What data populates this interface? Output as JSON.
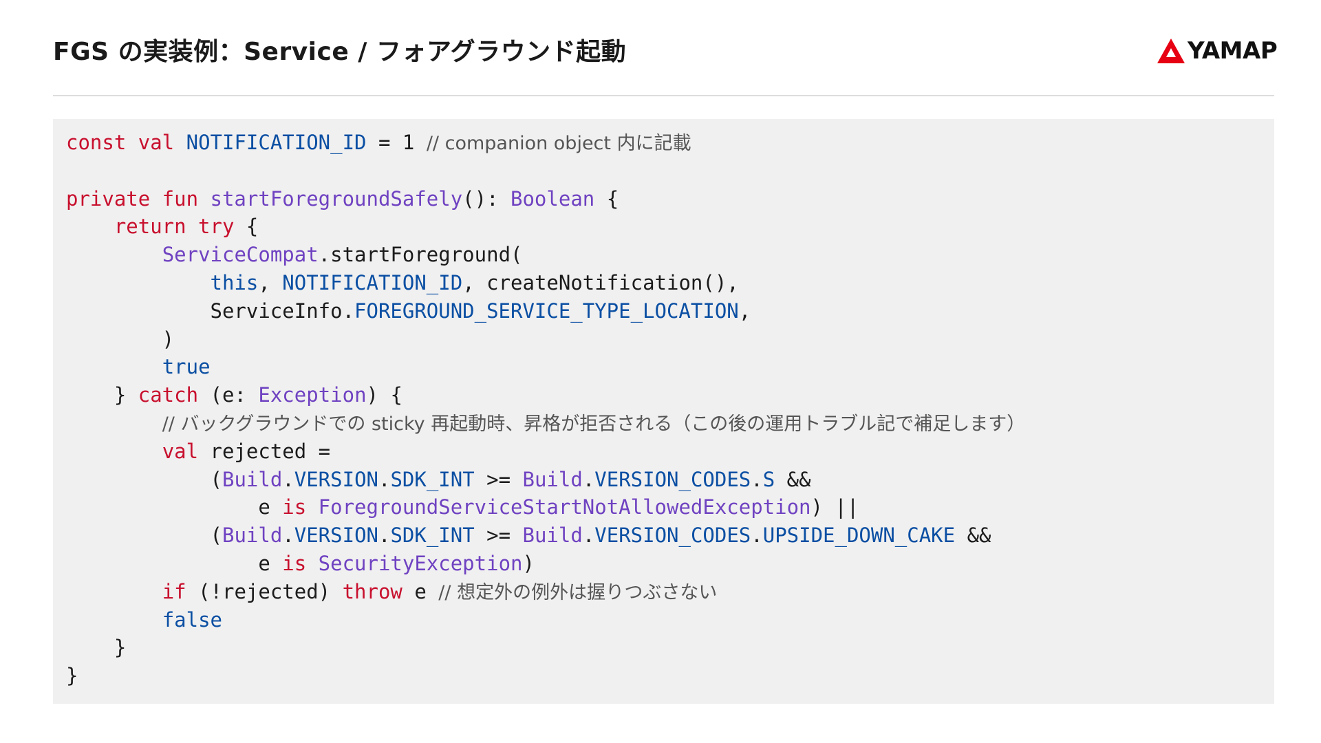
{
  "header": {
    "title": "FGS の実装例：Service / フォアグラウンド起動",
    "logo_text": "YAMAP"
  },
  "colors": {
    "keyword": "#c8102e",
    "type": "#6f42c1",
    "constant": "#0b4fa3",
    "comment": "#555555",
    "code_background": "#f0f0f0",
    "logo_red": "#e60012"
  },
  "code": {
    "lines": [
      [
        {
          "t": "const val ",
          "c": "kw"
        },
        {
          "t": "NOTIFICATION_ID",
          "c": "cn"
        },
        {
          "t": " = 1 "
        },
        {
          "t": "// ",
          "c": "cm"
        },
        {
          "t": "companion object 内に記載",
          "c": "cm"
        }
      ],
      [],
      [
        {
          "t": "private fun ",
          "c": "kw"
        },
        {
          "t": "startForegroundSafely",
          "c": "ty"
        },
        {
          "t": "(): "
        },
        {
          "t": "Boolean",
          "c": "ty"
        },
        {
          "t": " {"
        }
      ],
      [
        {
          "t": "    "
        },
        {
          "t": "return try",
          "c": "kw"
        },
        {
          "t": " {"
        }
      ],
      [
        {
          "t": "        "
        },
        {
          "t": "ServiceCompat",
          "c": "ty"
        },
        {
          "t": ".startForeground("
        }
      ],
      [
        {
          "t": "            "
        },
        {
          "t": "this",
          "c": "cn"
        },
        {
          "t": ", "
        },
        {
          "t": "NOTIFICATION_ID",
          "c": "cn"
        },
        {
          "t": ", createNotification(),"
        }
      ],
      [
        {
          "t": "            ServiceInfo."
        },
        {
          "t": "FOREGROUND_SERVICE_TYPE_LOCATION",
          "c": "cn"
        },
        {
          "t": ","
        }
      ],
      [
        {
          "t": "        )"
        }
      ],
      [
        {
          "t": "        "
        },
        {
          "t": "true",
          "c": "cn"
        }
      ],
      [
        {
          "t": "    } "
        },
        {
          "t": "catch",
          "c": "kw"
        },
        {
          "t": " (e: "
        },
        {
          "t": "Exception",
          "c": "ty"
        },
        {
          "t": ") {"
        }
      ],
      [
        {
          "t": "        "
        },
        {
          "t": "// ",
          "c": "cm"
        },
        {
          "t": "バックグラウンドでの sticky 再起動時、昇格が拒否される（この後の運用トラブル記で補足します）",
          "c": "cm"
        }
      ],
      [
        {
          "t": "        "
        },
        {
          "t": "val",
          "c": "kw"
        },
        {
          "t": " rejected ="
        }
      ],
      [
        {
          "t": "            ("
        },
        {
          "t": "Build",
          "c": "ty"
        },
        {
          "t": "."
        },
        {
          "t": "VERSION",
          "c": "cn"
        },
        {
          "t": "."
        },
        {
          "t": "SDK_INT",
          "c": "cn"
        },
        {
          "t": " >= "
        },
        {
          "t": "Build",
          "c": "ty"
        },
        {
          "t": "."
        },
        {
          "t": "VERSION_CODES",
          "c": "cn"
        },
        {
          "t": "."
        },
        {
          "t": "S",
          "c": "cn"
        },
        {
          "t": " &&"
        }
      ],
      [
        {
          "t": "                e "
        },
        {
          "t": "is",
          "c": "kw"
        },
        {
          "t": " "
        },
        {
          "t": "ForegroundServiceStartNotAllowedException",
          "c": "ty"
        },
        {
          "t": ") ||"
        }
      ],
      [
        {
          "t": "            ("
        },
        {
          "t": "Build",
          "c": "ty"
        },
        {
          "t": "."
        },
        {
          "t": "VERSION",
          "c": "cn"
        },
        {
          "t": "."
        },
        {
          "t": "SDK_INT",
          "c": "cn"
        },
        {
          "t": " >= "
        },
        {
          "t": "Build",
          "c": "ty"
        },
        {
          "t": "."
        },
        {
          "t": "VERSION_CODES",
          "c": "cn"
        },
        {
          "t": "."
        },
        {
          "t": "UPSIDE_DOWN_CAKE",
          "c": "cn"
        },
        {
          "t": " &&"
        }
      ],
      [
        {
          "t": "                e "
        },
        {
          "t": "is",
          "c": "kw"
        },
        {
          "t": " "
        },
        {
          "t": "SecurityException",
          "c": "ty"
        },
        {
          "t": ")"
        }
      ],
      [
        {
          "t": "        "
        },
        {
          "t": "if",
          "c": "kw"
        },
        {
          "t": " (!rejected) "
        },
        {
          "t": "throw",
          "c": "kw"
        },
        {
          "t": " e "
        },
        {
          "t": "// ",
          "c": "cm"
        },
        {
          "t": "想定外の例外は握りつぶさない",
          "c": "cm"
        }
      ],
      [
        {
          "t": "        "
        },
        {
          "t": "false",
          "c": "cn"
        }
      ],
      [
        {
          "t": "    }"
        }
      ],
      [
        {
          "t": "}"
        }
      ]
    ]
  }
}
